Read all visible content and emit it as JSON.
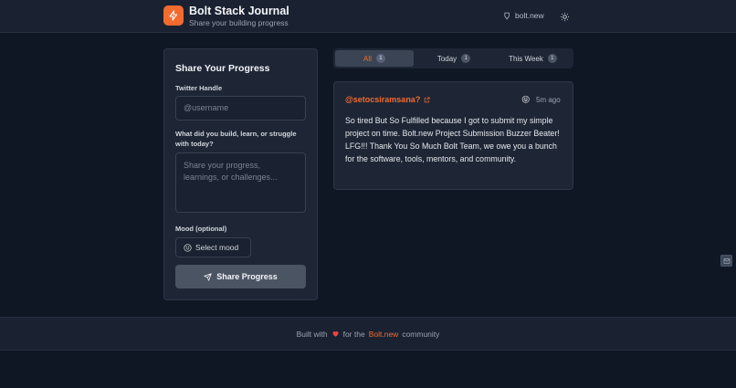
{
  "header": {
    "title": "Bolt Stack Journal",
    "subtitle": "Share your building progress",
    "bolt_link": "bolt.new"
  },
  "form": {
    "title": "Share Your Progress",
    "twitter_label": "Twitter Handle",
    "twitter_placeholder": "@username",
    "progress_label": "What did you build, learn, or struggle with today?",
    "progress_placeholder": "Share your progress, learnings, or challenges...",
    "mood_label": "Mood (optional)",
    "mood_button": "Select mood",
    "submit_button": "Share Progress"
  },
  "tabs": [
    {
      "label": "All",
      "count": "1"
    },
    {
      "label": "Today",
      "count": "1"
    },
    {
      "label": "This Week",
      "count": "1"
    }
  ],
  "post": {
    "user": "@setocsiramsana?",
    "mood_emoji": "😝",
    "time": "5m ago",
    "body": "So tired But So Fulfilled because I got to submit my simple project on time. Bolt.new Project Submission Buzzer Beater! LFG!!! Thank You So Much Bolt Team, we owe you a bunch for the software, tools, mentors, and community."
  },
  "footer": {
    "built_with": "Built with",
    "for_the": "for the",
    "link": "Bolt.new",
    "community": "community"
  },
  "colors": {
    "accent": "#f26a2e",
    "background": "#0f1624",
    "card": "#1e2636"
  }
}
